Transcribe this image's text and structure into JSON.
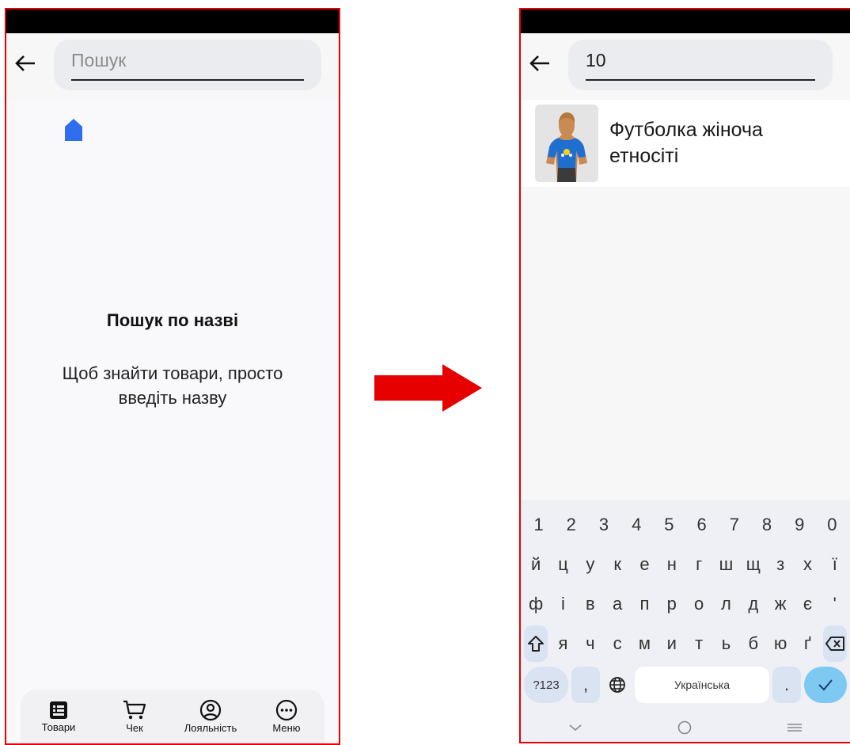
{
  "left_screen": {
    "search": {
      "placeholder": "Пошук",
      "value": ""
    },
    "empty_state": {
      "title": "Пошук по назві",
      "description": "Щоб знайти товари, просто введіть назву"
    },
    "bottom_nav": [
      {
        "label": "Товари",
        "icon": "products-icon"
      },
      {
        "label": "Чек",
        "icon": "cart-icon"
      },
      {
        "label": "Лояльність",
        "icon": "loyalty-icon"
      },
      {
        "label": "Меню",
        "icon": "menu-icon"
      }
    ]
  },
  "right_screen": {
    "search": {
      "value": "10"
    },
    "results": [
      {
        "title": "Футболка жіноча етносіті",
        "thumbnail": "woman-in-blue-tshirt-photo"
      }
    ],
    "keyboard": {
      "row_numbers": [
        "1",
        "2",
        "3",
        "4",
        "5",
        "6",
        "7",
        "8",
        "9",
        "0"
      ],
      "row_1": [
        "й",
        "ц",
        "у",
        "к",
        "е",
        "н",
        "г",
        "ш",
        "щ",
        "з",
        "х",
        "ї"
      ],
      "row_2": [
        "ф",
        "і",
        "в",
        "а",
        "п",
        "р",
        "о",
        "л",
        "д",
        "ж",
        "є",
        "'"
      ],
      "row_3": [
        "я",
        "ч",
        "с",
        "м",
        "и",
        "т",
        "ь",
        "б",
        "ю",
        "ґ"
      ],
      "symbols_key": "?123",
      "comma_key": ",",
      "space_label": "Українська",
      "period_key": "."
    }
  },
  "colors": {
    "highlight_border": "#e60000",
    "arrow": "#e60000",
    "accent_blue": "#2f6fef",
    "enter_key": "#7ec9f2"
  }
}
